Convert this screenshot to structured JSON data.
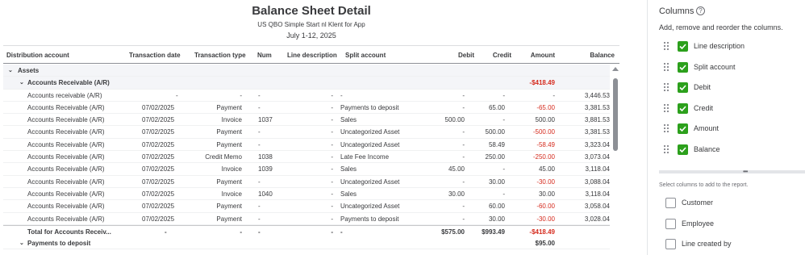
{
  "report": {
    "title": "Balance Sheet Detail",
    "company": "US QBO Simple Start nl Klent for App",
    "date_range": "July 1-12, 2025",
    "columns": [
      "Distribution account",
      "Transaction date",
      "Transaction type",
      "Num",
      "Line description",
      "Split account",
      "Debit",
      "Credit",
      "Amount",
      "Balance"
    ],
    "assets_label": "Assets",
    "ar_group": {
      "label": "Accounts Receivable (A/R)",
      "amount": "-$418.49"
    },
    "rows": [
      {
        "acct": "Accounts receivable (A/R)",
        "date": "-",
        "type": "-",
        "num": "-",
        "desc": "-",
        "split": "-",
        "debit": "-",
        "credit": "-",
        "amount": "-",
        "amount_neg": false,
        "balance": "3,446.53"
      },
      {
        "acct": "Accounts Receivable (A/R)",
        "date": "07/02/2025",
        "type": "Payment",
        "num": "-",
        "desc": "-",
        "split": "Payments to deposit",
        "debit": "-",
        "credit": "65.00",
        "amount": "-65.00",
        "amount_neg": true,
        "balance": "3,381.53"
      },
      {
        "acct": "Accounts Receivable (A/R)",
        "date": "07/02/2025",
        "type": "Invoice",
        "num": "1037",
        "desc": "-",
        "split": "Sales",
        "debit": "500.00",
        "credit": "-",
        "amount": "500.00",
        "amount_neg": false,
        "balance": "3,881.53"
      },
      {
        "acct": "Accounts Receivable (A/R)",
        "date": "07/02/2025",
        "type": "Payment",
        "num": "-",
        "desc": "-",
        "split": "Uncategorized Asset",
        "debit": "-",
        "credit": "500.00",
        "amount": "-500.00",
        "amount_neg": true,
        "balance": "3,381.53"
      },
      {
        "acct": "Accounts Receivable (A/R)",
        "date": "07/02/2025",
        "type": "Payment",
        "num": "-",
        "desc": "-",
        "split": "Uncategorized Asset",
        "debit": "-",
        "credit": "58.49",
        "amount": "-58.49",
        "amount_neg": true,
        "balance": "3,323.04"
      },
      {
        "acct": "Accounts Receivable (A/R)",
        "date": "07/02/2025",
        "type": "Credit Memo",
        "num": "1038",
        "desc": "-",
        "split": "Late Fee Income",
        "debit": "-",
        "credit": "250.00",
        "amount": "-250.00",
        "amount_neg": true,
        "balance": "3,073.04"
      },
      {
        "acct": "Accounts Receivable (A/R)",
        "date": "07/02/2025",
        "type": "Invoice",
        "num": "1039",
        "desc": "-",
        "split": "Sales",
        "debit": "45.00",
        "credit": "-",
        "amount": "45.00",
        "amount_neg": false,
        "balance": "3,118.04"
      },
      {
        "acct": "Accounts Receivable (A/R)",
        "date": "07/02/2025",
        "type": "Payment",
        "num": "-",
        "desc": "-",
        "split": "Uncategorized Asset",
        "debit": "-",
        "credit": "30.00",
        "amount": "-30.00",
        "amount_neg": true,
        "balance": "3,088.04"
      },
      {
        "acct": "Accounts Receivable (A/R)",
        "date": "07/02/2025",
        "type": "Invoice",
        "num": "1040",
        "desc": "-",
        "split": "Sales",
        "debit": "30.00",
        "credit": "-",
        "amount": "30.00",
        "amount_neg": false,
        "balance": "3,118.04"
      },
      {
        "acct": "Accounts Receivable (A/R)",
        "date": "07/02/2025",
        "type": "Payment",
        "num": "-",
        "desc": "-",
        "split": "Uncategorized Asset",
        "debit": "-",
        "credit": "60.00",
        "amount": "-60.00",
        "amount_neg": true,
        "balance": "3,058.04"
      },
      {
        "acct": "Accounts Receivable (A/R)",
        "date": "07/02/2025",
        "type": "Payment",
        "num": "-",
        "desc": "-",
        "split": "Payments to deposit",
        "debit": "-",
        "credit": "30.00",
        "amount": "-30.00",
        "amount_neg": true,
        "balance": "3,028.04"
      }
    ],
    "ar_total": {
      "acct": "Total for Accounts Receiv...",
      "date": "-",
      "type": "-",
      "num": "-",
      "desc": "-",
      "split": "-",
      "debit": "$575.00",
      "credit": "$993.49",
      "amount": "-$418.49",
      "balance": ""
    },
    "ptd_group": {
      "label": "Payments to deposit",
      "amount": "$95.00"
    }
  },
  "panel": {
    "title": "Columns",
    "subtitle": "Add, remove and reorder the columns.",
    "selected": [
      "Line description",
      "Split account",
      "Debit",
      "Credit",
      "Amount",
      "Balance"
    ],
    "add_hint": "Select columns to add to the report.",
    "available": [
      "Customer",
      "Employee",
      "Line created by"
    ]
  },
  "colors": {
    "accent_green": "#2ca01c",
    "negative_red": "#d52b1e"
  }
}
